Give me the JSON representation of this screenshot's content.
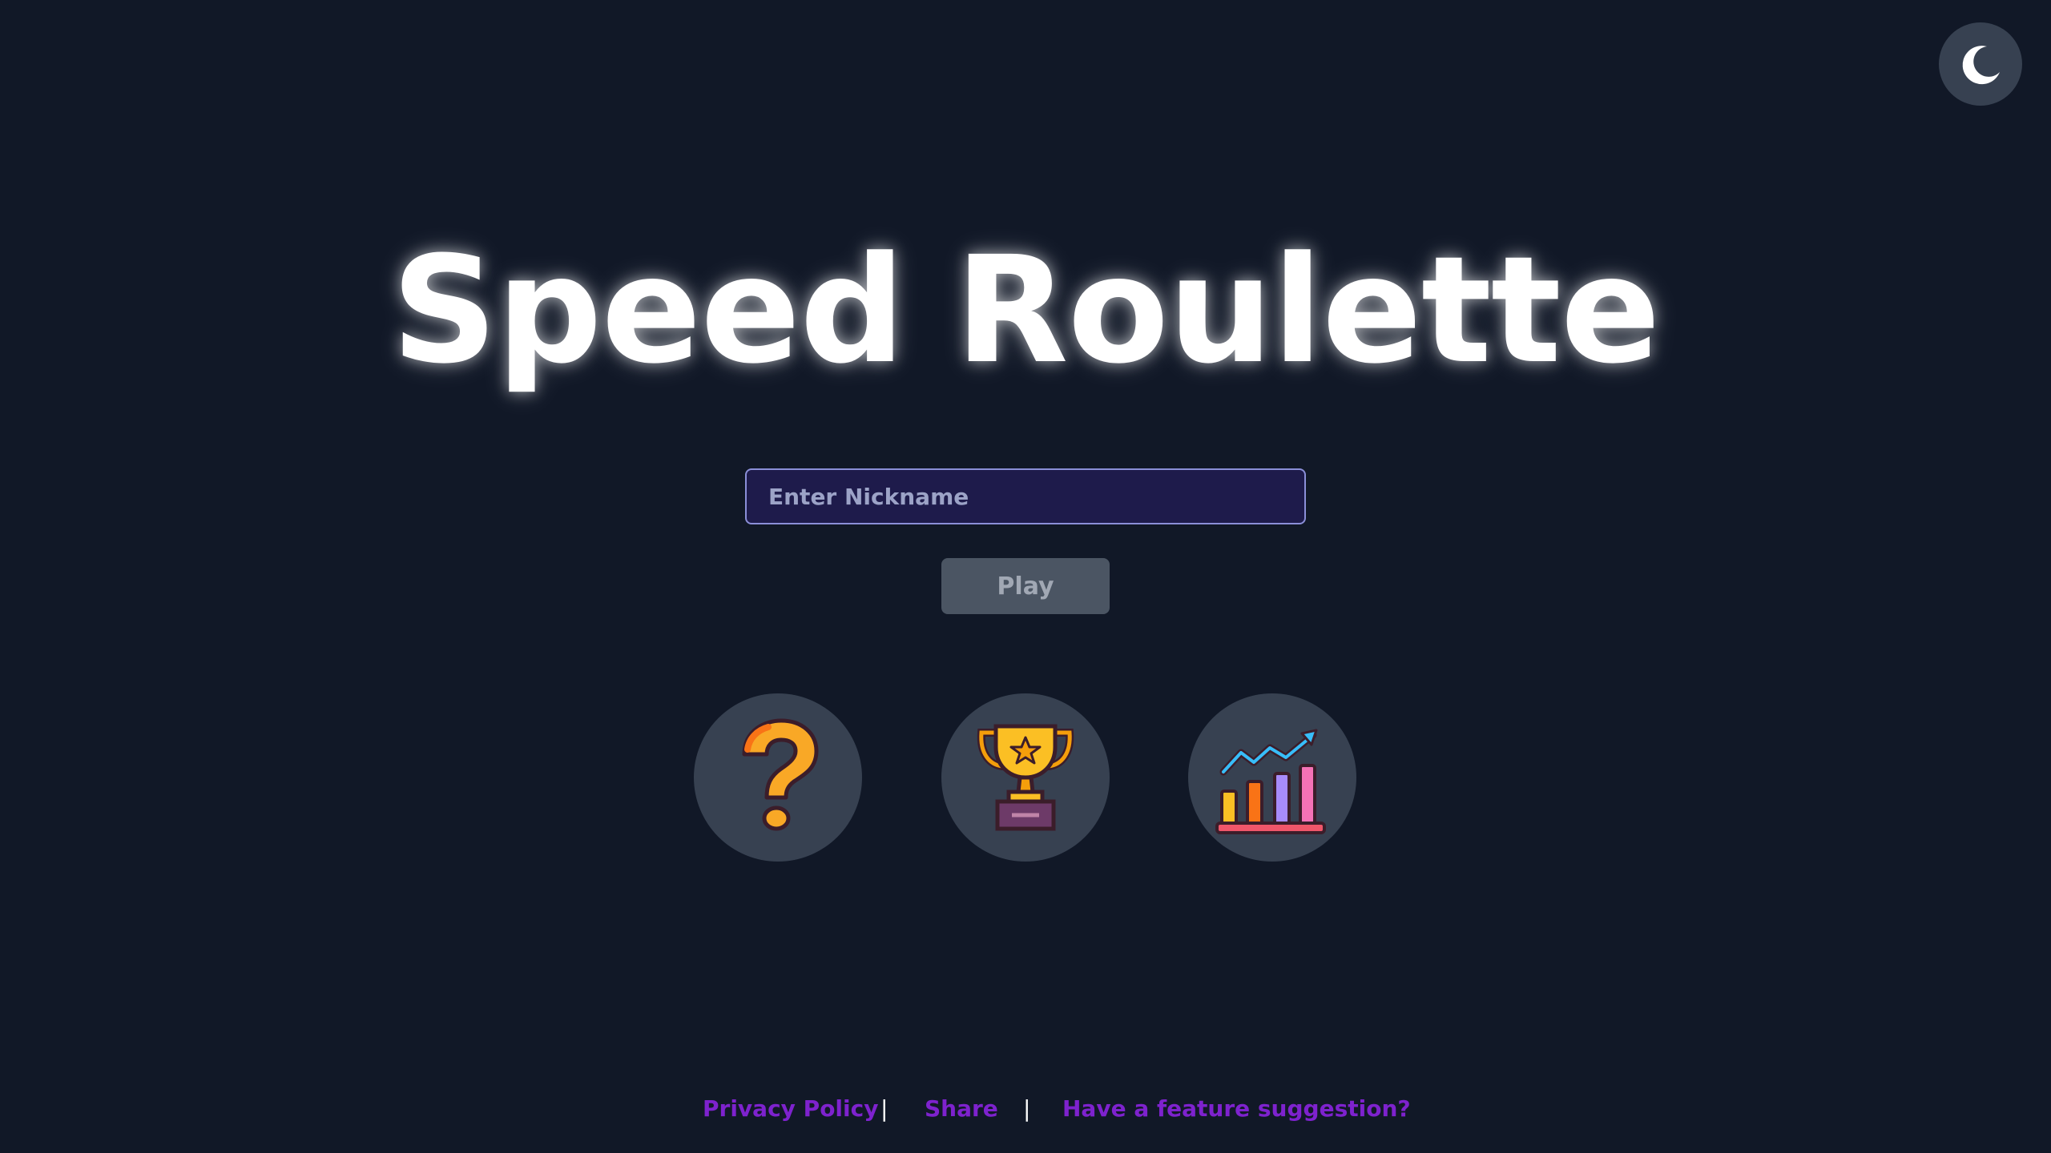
{
  "app": {
    "title": "Speed Roulette"
  },
  "theme_toggle": {
    "icon": "moon-icon"
  },
  "nickname": {
    "placeholder": "Enter Nickname",
    "value": ""
  },
  "play_button": {
    "label": "Play",
    "state": "disabled"
  },
  "actions": [
    {
      "icon": "question-mark-icon"
    },
    {
      "icon": "trophy-icon"
    },
    {
      "icon": "bar-chart-icon"
    }
  ],
  "footer": {
    "links": [
      {
        "label": "Privacy Policy"
      },
      {
        "label": "Share"
      },
      {
        "label": "Have a feature suggestion?"
      }
    ],
    "separator": "|"
  },
  "colors": {
    "background": "#111827",
    "button_bg": "#374151",
    "input_bg": "#1e1b4b",
    "link": "#7e22ce"
  }
}
